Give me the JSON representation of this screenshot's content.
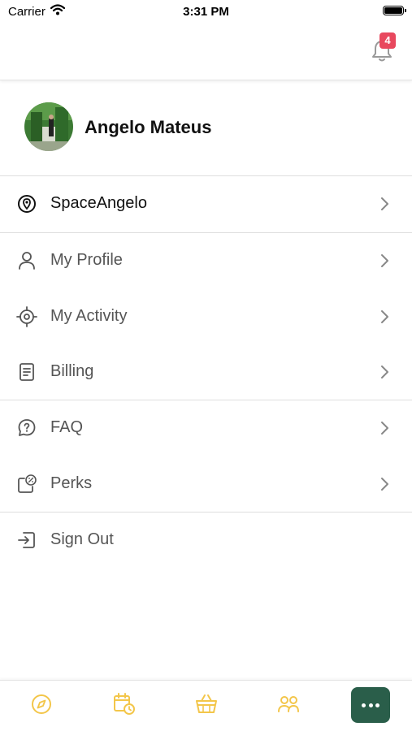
{
  "status_bar": {
    "carrier": "Carrier",
    "time": "3:31 PM"
  },
  "header": {
    "notification_count": "4"
  },
  "profile": {
    "name": "Angelo Mateus"
  },
  "menu": {
    "space": "SpaceAngelo",
    "my_profile": "My Profile",
    "my_activity": "My Activity",
    "billing": "Billing",
    "faq": "FAQ",
    "perks": "Perks",
    "sign_out": "Sign Out"
  },
  "colors": {
    "accent": "#2a5e4a",
    "tab_icon": "#f3c64a",
    "badge": "#e8485e",
    "menu_icon": "#555555"
  },
  "tab_bar": {
    "tabs": [
      {
        "icon": "compass-icon"
      },
      {
        "icon": "calendar-clock-icon"
      },
      {
        "icon": "basket-icon"
      },
      {
        "icon": "people-icon"
      },
      {
        "icon": "more-icon",
        "active": true
      }
    ]
  }
}
